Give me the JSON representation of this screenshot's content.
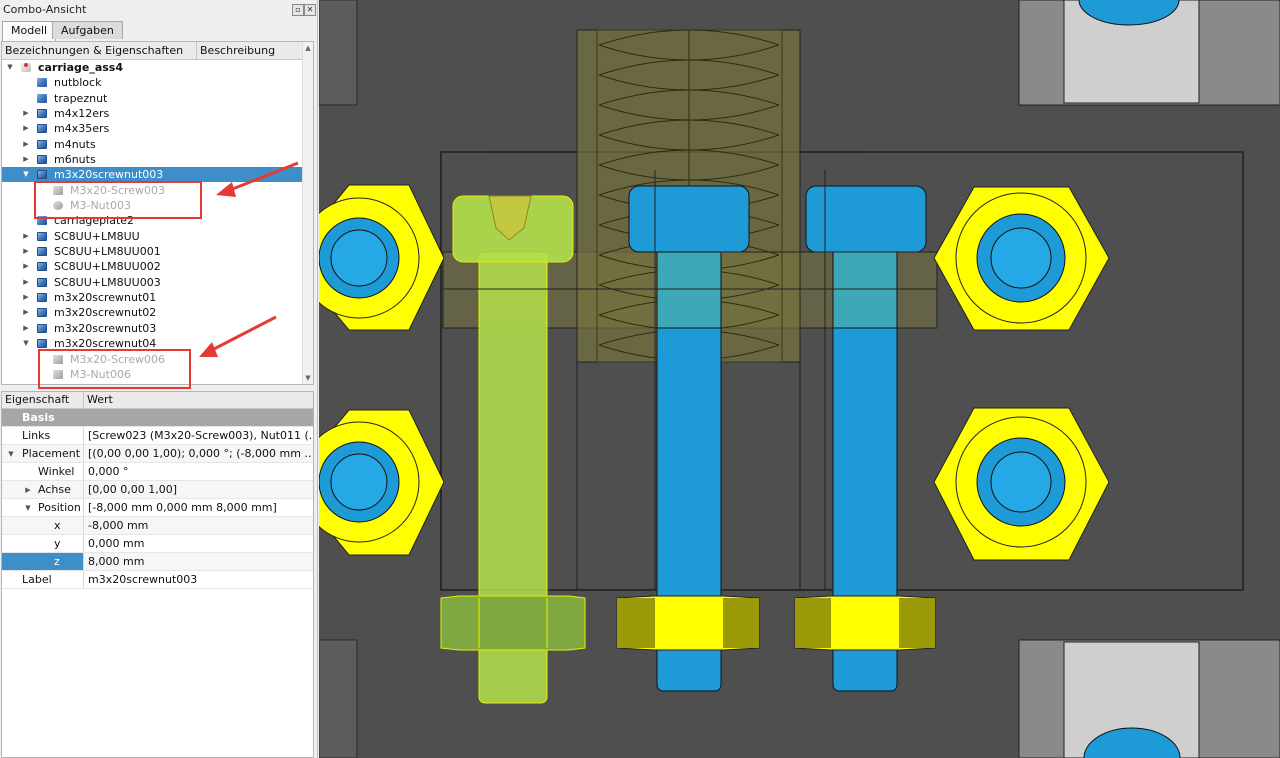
{
  "panel": {
    "title": "Combo-Ansicht",
    "tabs": [
      {
        "label": "Modell"
      },
      {
        "label": "Aufgaben"
      }
    ]
  },
  "tree": {
    "columns": [
      "Bezeichnungen & Eigenschaften",
      "Beschreibung"
    ],
    "items": [
      {
        "label": "carriage_ass4"
      },
      {
        "label": "nutblock"
      },
      {
        "label": "trapeznut"
      },
      {
        "label": "m4x12ers"
      },
      {
        "label": "m4x35ers"
      },
      {
        "label": "m4nuts"
      },
      {
        "label": "m6nuts"
      },
      {
        "label": "m3x20screwnut003"
      },
      {
        "label": "M3x20-Screw003"
      },
      {
        "label": "M3-Nut003"
      },
      {
        "label": "carriageplate2"
      },
      {
        "label": "SC8UU+LM8UU"
      },
      {
        "label": "SC8UU+LM8UU001"
      },
      {
        "label": "SC8UU+LM8UU002"
      },
      {
        "label": "SC8UU+LM8UU003"
      },
      {
        "label": "m3x20screwnut01"
      },
      {
        "label": "m3x20screwnut02"
      },
      {
        "label": "m3x20screwnut03"
      },
      {
        "label": "m3x20screwnut04"
      },
      {
        "label": "M3x20-Screw006"
      },
      {
        "label": "M3-Nut006"
      }
    ]
  },
  "properties": {
    "columns": [
      "Eigenschaft",
      "Wert"
    ],
    "group": "Basis",
    "rows": [
      {
        "name": "Links",
        "value": "[Screw023 (M3x20-Screw003), Nut011 (..."
      },
      {
        "name": "Placement",
        "value": "[(0,00 0,00 1,00); 0,000 °; (-8,000 mm  ..."
      },
      {
        "name": "Winkel",
        "value": "0,000 °"
      },
      {
        "name": "Achse",
        "value": "[0,00 0,00 1,00]"
      },
      {
        "name": "Position",
        "value": "[-8,000 mm  0,000 mm  8,000 mm]"
      },
      {
        "name": "x",
        "value": "-8,000 mm"
      },
      {
        "name": "y",
        "value": "0,000 mm"
      },
      {
        "name": "z",
        "value": "8,000 mm"
      },
      {
        "name": "Label",
        "value": "m3x20screwnut003"
      }
    ]
  },
  "colors": {
    "selection": "#3d8ec9",
    "annotation": "#e53935",
    "viewport_bg": "#515151",
    "highlight_yellow": "#ffff00",
    "part_blue": "#1e9ad6",
    "preselect_green": "#b4e04a"
  }
}
